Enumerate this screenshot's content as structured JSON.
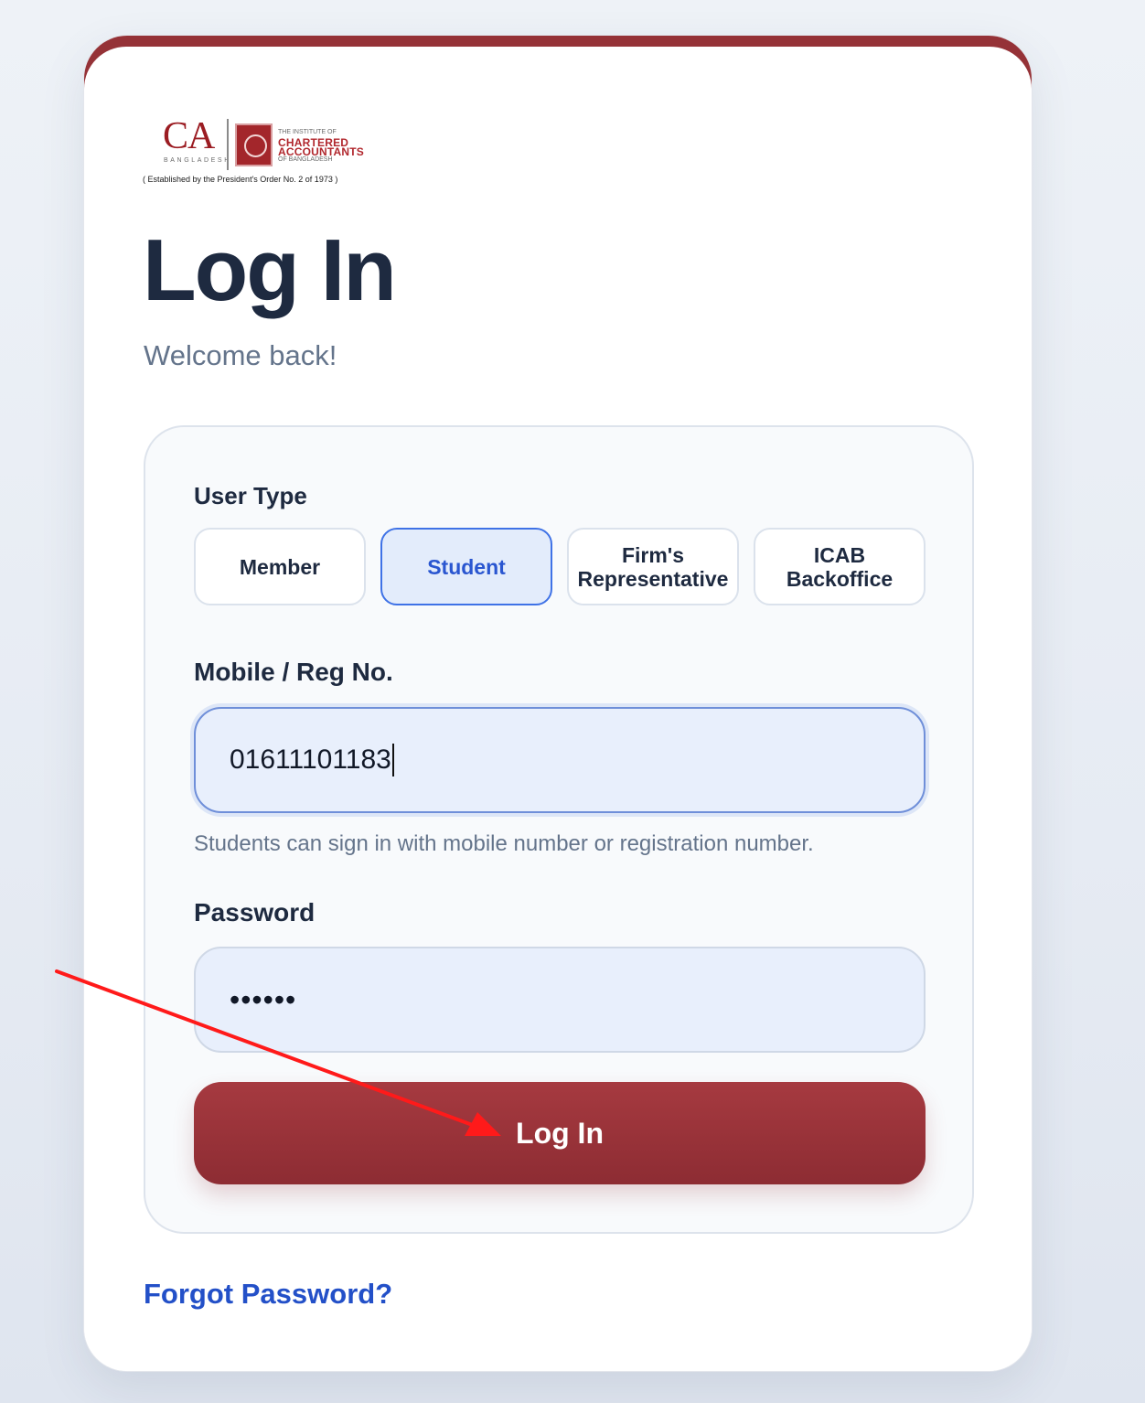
{
  "logo": {
    "ca_mark": "CA",
    "country": "BANGLADESH",
    "institute_line1": "THE INSTITUTE OF",
    "institute_line2": "CHARTERED",
    "institute_line3": "ACCOUNTANTS",
    "institute_line4": "OF BANGLADESH",
    "established": "( Established by the President's Order No. 2 of 1973 )"
  },
  "title": "Log In",
  "subtitle": "Welcome back!",
  "form": {
    "user_type_label": "User Type",
    "user_types": [
      {
        "label": "Member",
        "selected": false
      },
      {
        "label": "Student",
        "selected": true
      },
      {
        "label": "Firm's\nRepresentative",
        "selected": false
      },
      {
        "label": "ICAB\nBackoffice",
        "selected": false
      }
    ],
    "mobile_label": "Mobile / Reg No.",
    "mobile_value": "01611101183",
    "mobile_hint": "Students can sign in with mobile number or registration number.",
    "password_label": "Password",
    "password_value": "••••••",
    "submit_label": "Log In"
  },
  "forgot_password": "Forgot Password?",
  "colors": {
    "brand": "#953237",
    "accent": "#3f72e6",
    "link": "#2350c8",
    "annotation_arrow": "#ff0000"
  }
}
